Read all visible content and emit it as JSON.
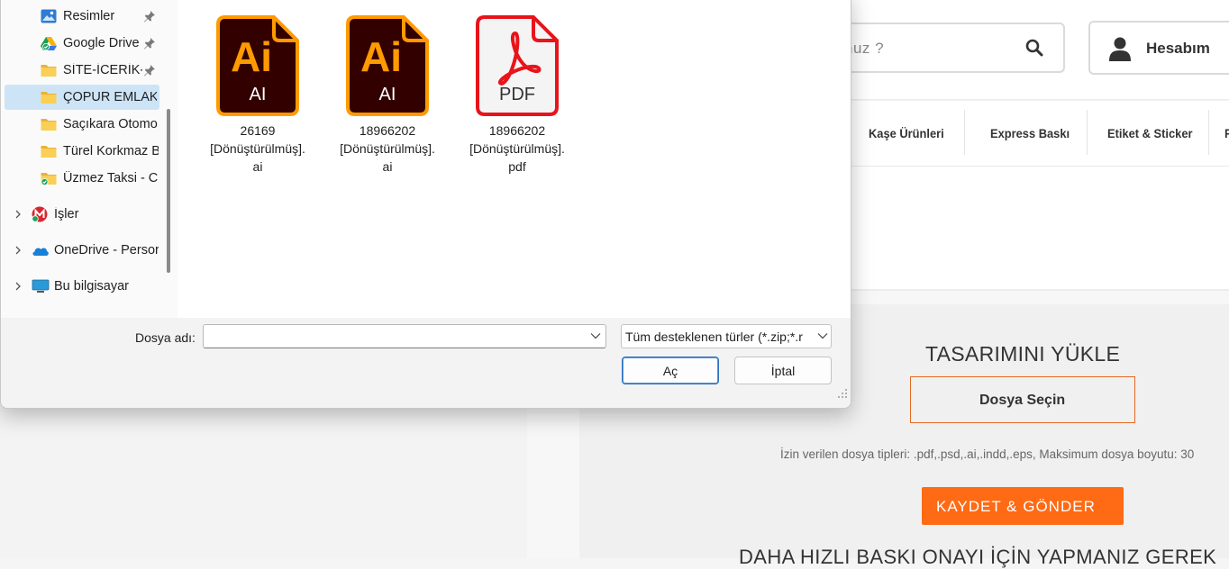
{
  "website": {
    "search": {
      "placeholder": "nuz ?"
    },
    "account": {
      "label": "Hesabım"
    },
    "nav": [
      {
        "label": "Kaşe Ürünleri"
      },
      {
        "label": "Express Baskı"
      },
      {
        "label": "Etiket & Sticker"
      },
      {
        "label": "F"
      }
    ],
    "upload": {
      "title": "TASARIMINI YÜKLE",
      "file_button": "Dosya Seçin",
      "hint": "İzin verilen dosya tipleri: .pdf,.psd,.ai,.indd,.eps, Maksimum dosya boyutu: 30",
      "submit": "KAYDET & GÖNDER",
      "bottom_heading": "DAHA HIZLI BASKI ONAYI İÇİN YAPMANIZ GEREK"
    },
    "colors": {
      "accent": "#ff6a14",
      "border_accent": "#e26a22"
    }
  },
  "dialog": {
    "sidebar": [
      {
        "label": "Resimler",
        "icon": "pictures-icon",
        "pinned": true
      },
      {
        "label": "Google Drive",
        "icon": "google-drive-icon",
        "pinned": true
      },
      {
        "label": "SİTE-İCERİK-I",
        "icon": "folder-icon",
        "pinned": true
      },
      {
        "label": "ÇOPUR EMLAK",
        "icon": "folder-icon",
        "selected": true
      },
      {
        "label": "Saçıkara Otomo",
        "icon": "folder-icon"
      },
      {
        "label": "Türel Korkmaz B",
        "icon": "folder-icon"
      },
      {
        "label": "Üzmez Taksi - Cu",
        "icon": "folder-synced-icon"
      },
      {
        "label": "İşler",
        "icon": "mega-icon",
        "expandable": true
      },
      {
        "label": "OneDrive - Persor",
        "icon": "onedrive-icon",
        "expandable": true
      },
      {
        "label": "Bu bilgisayar",
        "icon": "computer-icon",
        "expandable": true
      }
    ],
    "files": [
      {
        "name_line1": "26169",
        "name_line2": "[Dönüştürülmüş].",
        "name_line3": "ai",
        "badge": "AI",
        "type": "illustrator-file-icon"
      },
      {
        "name_line1": "18966202",
        "name_line2": "[Dönüştürülmüş].",
        "name_line3": "ai",
        "badge": "AI",
        "type": "illustrator-file-icon"
      },
      {
        "name_line1": "18966202",
        "name_line2": "[Dönüştürülmüş].",
        "name_line3": "pdf",
        "badge": "PDF",
        "type": "pdf-file-icon"
      }
    ],
    "filename_label": "Dosya adı:",
    "filename_value": "",
    "filetype": "Tüm desteklenen türler (*.zip;*.r",
    "open_button": "Aç",
    "cancel_button": "İptal"
  }
}
